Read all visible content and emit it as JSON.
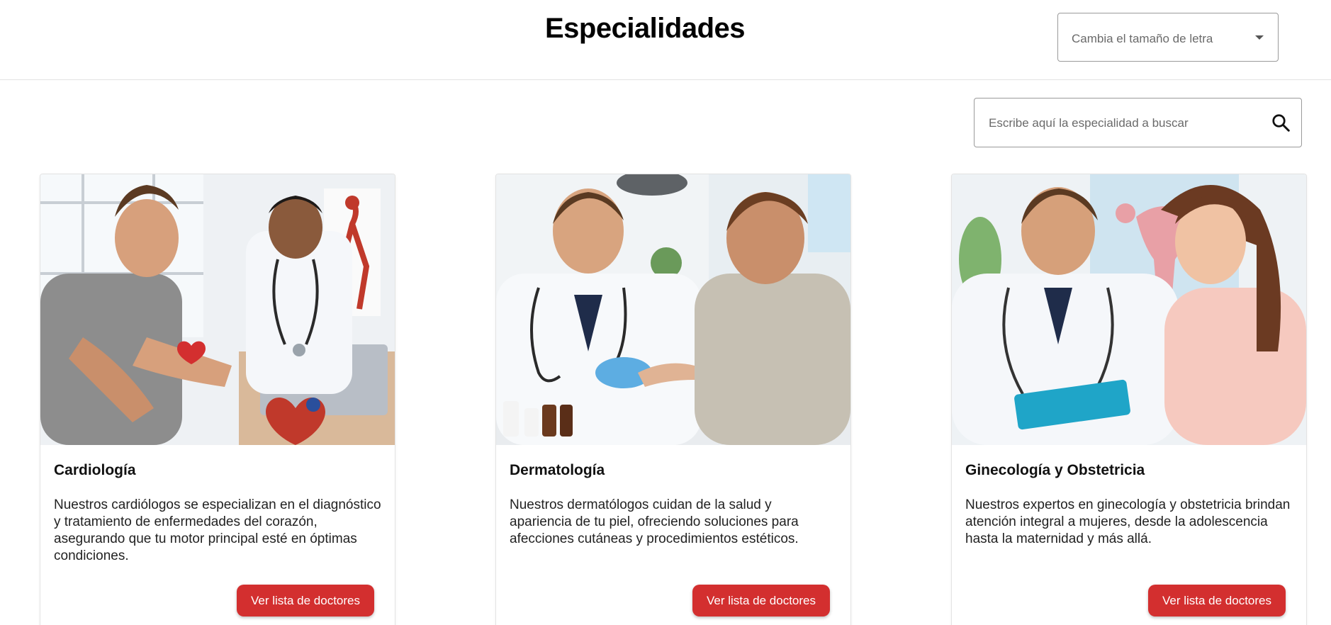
{
  "header": {
    "title": "Especialidades",
    "font_size_select": {
      "label": "Cambia el tamaño de letra"
    }
  },
  "search": {
    "placeholder": "Escribe aquí la especialidad a buscar"
  },
  "colors": {
    "accent": "#d32f2f",
    "border": "#9a9a9a",
    "divider": "#e2e2e2"
  },
  "cards": [
    {
      "title": "Cardiología",
      "description": "Nuestros cardiólogos se especializan en el diagnóstico y tratamiento de enfermedades del corazón, asegurando que tu motor principal esté en óptimas condiciones.",
      "button": "Ver lista de doctores",
      "image": "doctor-with-patient-heart-illustration"
    },
    {
      "title": "Dermatología",
      "description": "Nuestros dermatólogos cuidan de la salud y apariencia de tu piel, ofreciendo soluciones para afecciones cutáneas y procedimientos estéticos.",
      "button": "Ver lista de doctores",
      "image": "doctor-examining-patient-hand-illustration"
    },
    {
      "title": "Ginecología y Obstetricia",
      "description": "Nuestros expertos en ginecología y obstetricia brindan atención integral a mujeres, desde la adolescencia hasta la maternidad y más allá.",
      "button": "Ver lista de doctores",
      "image": "doctor-with-female-patient-illustration"
    }
  ]
}
